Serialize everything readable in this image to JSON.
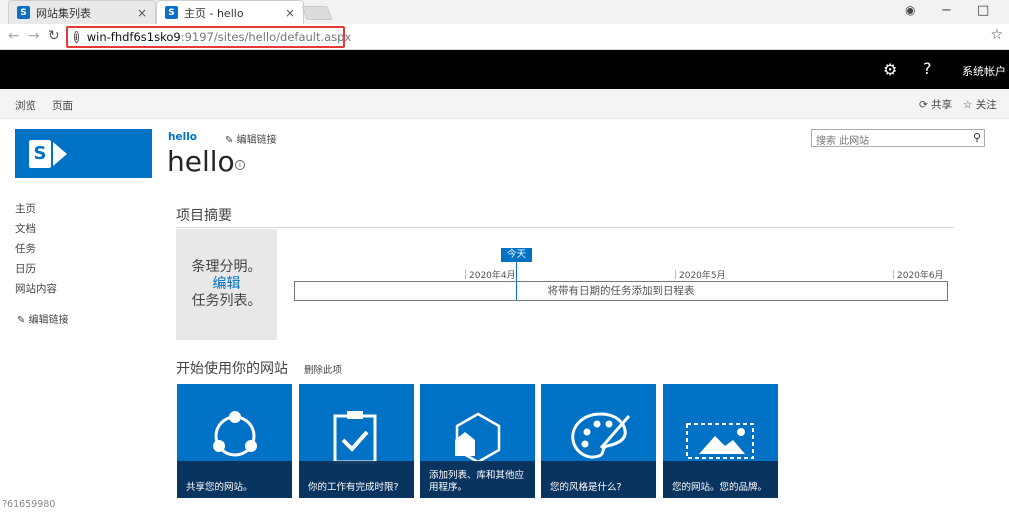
{
  "browser": {
    "tabs": [
      {
        "title": "网站集列表",
        "close": "×"
      },
      {
        "title": "主页 - hello",
        "close": "×"
      }
    ],
    "favicon_letter": "S",
    "url_host": "win-fhdf6s1sko9",
    "url_path": ":9197/sites/hello/default.aspx",
    "window_controls": [
      "−",
      "□"
    ]
  },
  "suitebar": {
    "account": "系统帐户"
  },
  "ribbon": {
    "tabs": [
      "浏览",
      "页面"
    ],
    "share": "共享",
    "follow": "关注"
  },
  "site": {
    "breadcrumb": "hello",
    "edit_links": "编辑链接",
    "title": "hello",
    "search_placeholder": "搜索 此网站"
  },
  "leftnav": {
    "items": [
      "主页",
      "文档",
      "任务",
      "日历",
      "网站内容"
    ],
    "edit_links": "编辑链接"
  },
  "project_summary": {
    "title": "项目摘要",
    "card_line1": "条理分明。",
    "card_edit": "编辑",
    "card_line3": "任务列表。",
    "today": "今天",
    "months": [
      "2020年4月",
      "2020年5月",
      "2020年6月"
    ],
    "timeline_text": "将带有日期的任务添加到日程表"
  },
  "getting_started": {
    "title": "开始使用你的网站",
    "remove": "删除此项",
    "tiles": [
      {
        "caption": "共享您的网站。",
        "icon": "share-icon"
      },
      {
        "caption": "你的工作有完成时限?",
        "icon": "clipboard-check-icon"
      },
      {
        "caption": "添加列表、库和其他应用程序。",
        "icon": "app-hexagon-icon"
      },
      {
        "caption": "您的风格是什么?",
        "icon": "palette-icon"
      },
      {
        "caption": "您的网站。您的品牌。",
        "icon": "image-icon"
      }
    ]
  },
  "footer_id": "?61659980",
  "colors": {
    "accent": "#0072c6",
    "suitebar": "#000000",
    "tile_band": "#0a2f57"
  }
}
